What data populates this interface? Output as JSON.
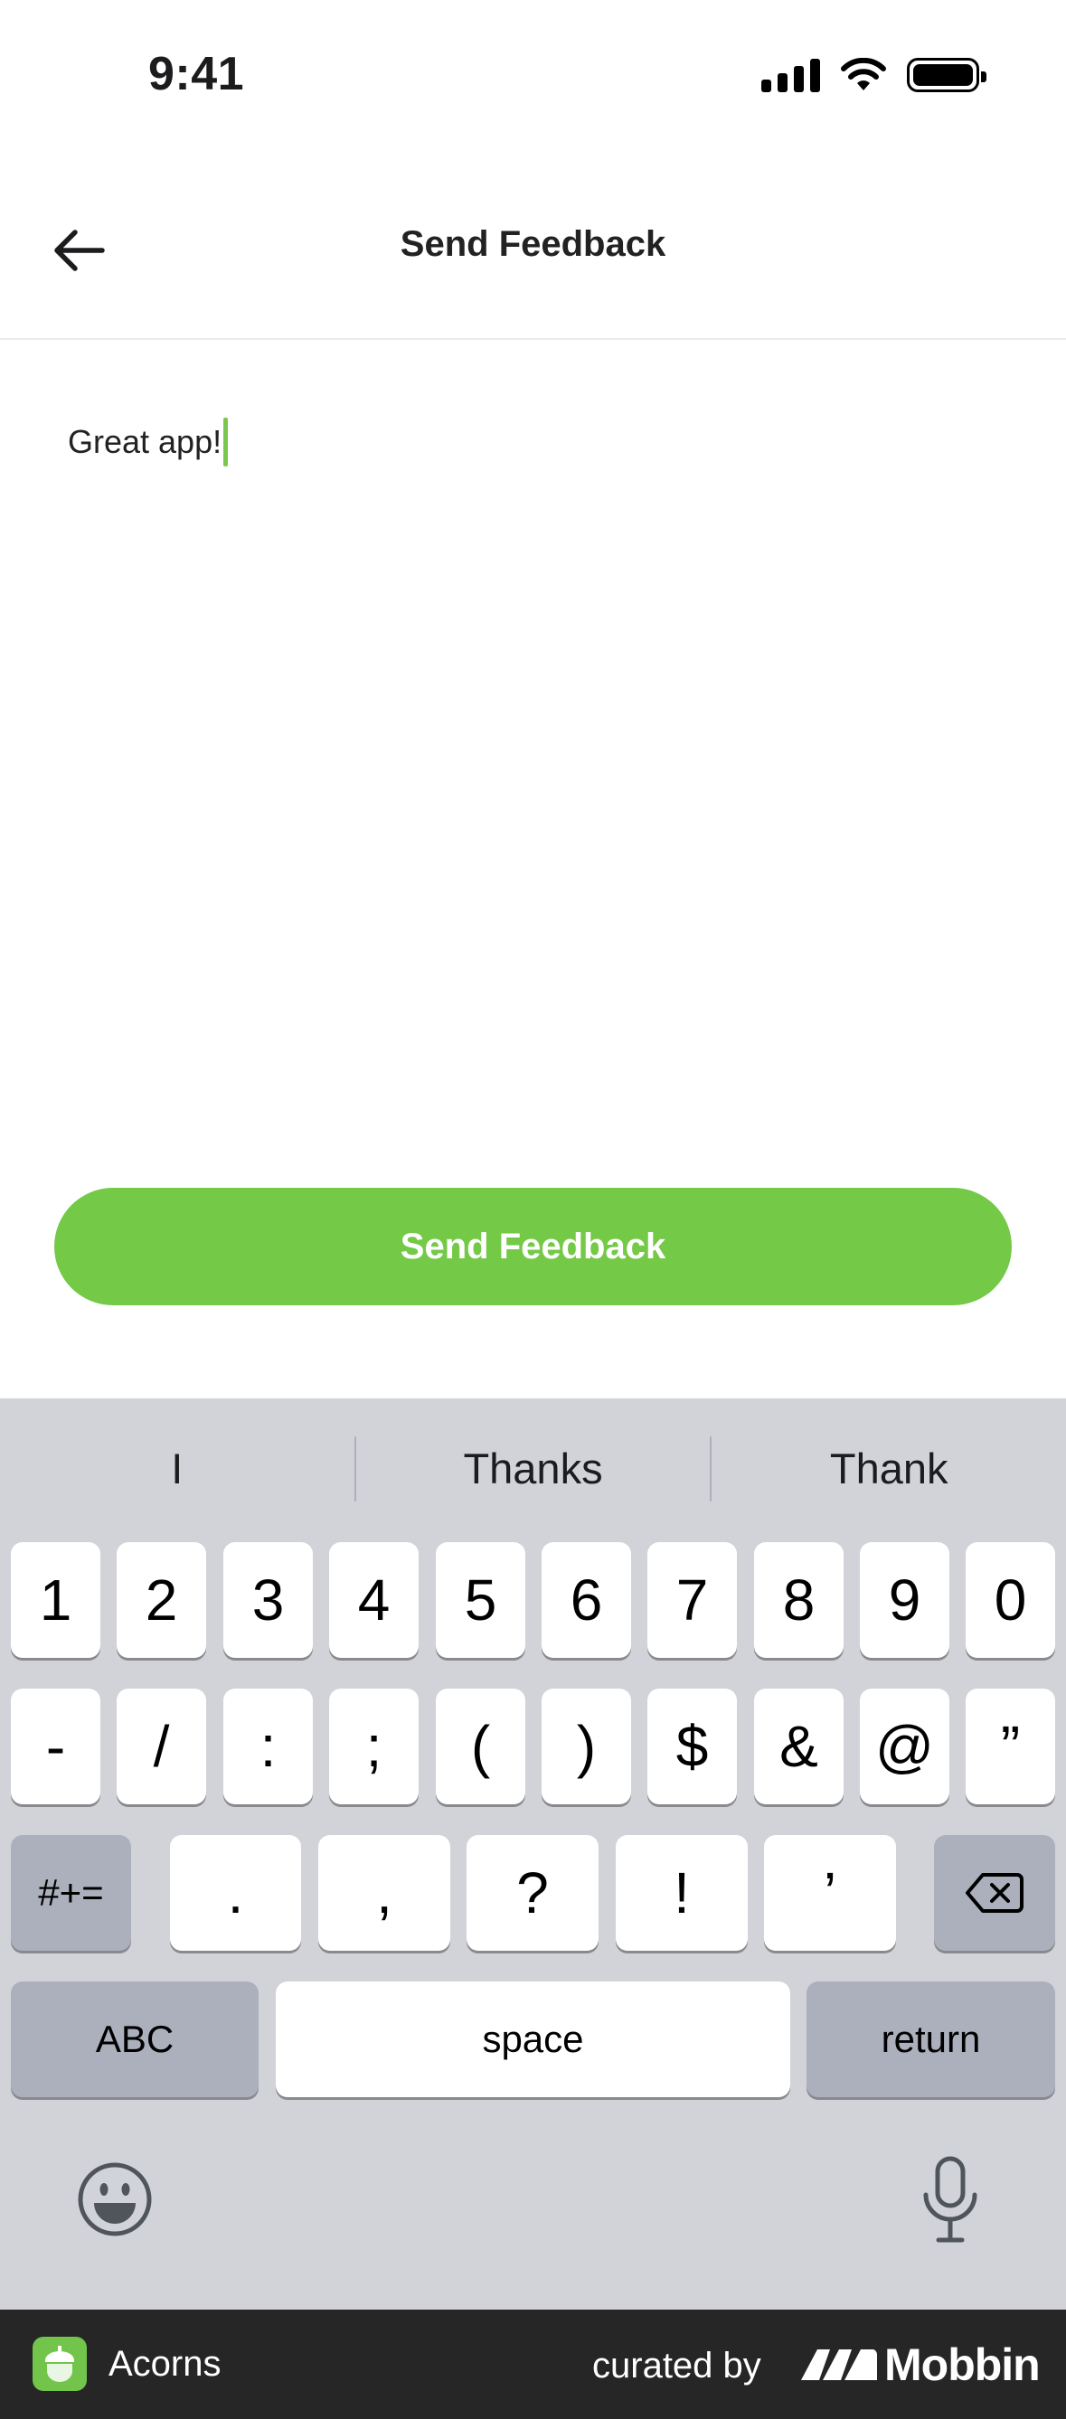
{
  "status_bar": {
    "time": "9:41"
  },
  "header": {
    "title": "Send Feedback"
  },
  "feedback": {
    "text": "Great app!"
  },
  "send_button": {
    "label": "Send Feedback"
  },
  "keyboard": {
    "suggestions": [
      "I",
      "Thanks",
      "Thank"
    ],
    "row1": [
      "1",
      "2",
      "3",
      "4",
      "5",
      "6",
      "7",
      "8",
      "9",
      "0"
    ],
    "row2": [
      "-",
      "/",
      ":",
      ";",
      "(",
      ")",
      "$",
      "&",
      "@",
      "”"
    ],
    "row3_toggle": "#+=",
    "row3": [
      ".",
      ",",
      "?",
      "!",
      "’"
    ],
    "abc": "ABC",
    "space": "space",
    "return": "return"
  },
  "footer": {
    "app_name": "Acorns",
    "curated_by": "curated by",
    "brand": "Mobbin"
  },
  "colors": {
    "accent": "#74c947",
    "keyboard_bg": "#d1d3d9",
    "footer_bg": "#262626"
  }
}
